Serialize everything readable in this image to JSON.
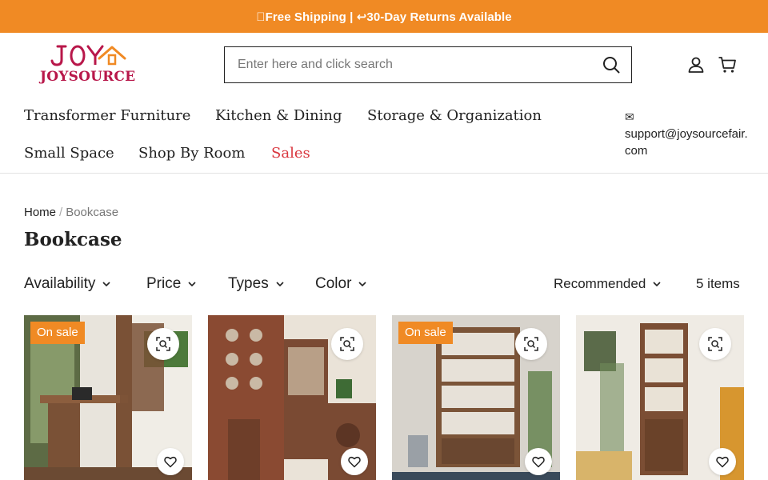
{
  "announcement": {
    "text": "\u0000Free Shipping | ↩30-Day Returns Available"
  },
  "brand": {
    "logo_text": "JOYSOURCE",
    "logo_mark": "JOY",
    "color": "#b8174a",
    "accent": "#f08a24"
  },
  "search": {
    "placeholder": "Enter here and click search",
    "value": ""
  },
  "header_icons": {
    "account": "user-icon",
    "cart": "cart-icon"
  },
  "nav": {
    "items": [
      {
        "label": "Transformer Furniture"
      },
      {
        "label": "Kitchen & Dining"
      },
      {
        "label": "Storage & Organization"
      },
      {
        "label": "Small Space"
      },
      {
        "label": "Shop By Room"
      },
      {
        "label": "Sales"
      }
    ],
    "support": {
      "icon": "✉",
      "email": "support@joysourcefair.com"
    }
  },
  "breadcrumb": {
    "home": "Home",
    "separator": "/",
    "current": "Bookcase"
  },
  "page": {
    "title": "Bookcase"
  },
  "filters": [
    {
      "label": "Availability"
    },
    {
      "label": "Price"
    },
    {
      "label": "Types"
    },
    {
      "label": "Color"
    }
  ],
  "sort": {
    "label": "Recommended"
  },
  "count": {
    "text": "5 items"
  },
  "products": [
    {
      "badge": "On sale"
    },
    {
      "badge": ""
    },
    {
      "badge": "On sale"
    },
    {
      "badge": ""
    }
  ]
}
